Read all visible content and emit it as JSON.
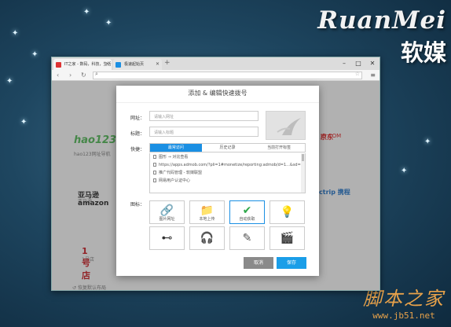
{
  "brand": {
    "english": "RuanMei",
    "chinese": "软媒"
  },
  "watermark": {
    "chinese": "脚本之家",
    "url": "www.jb51.net"
  },
  "browser": {
    "tabs": [
      {
        "label": "IT之家 - 数码，科技，生活"
      },
      {
        "label": "极速起始页"
      }
    ],
    "new_tab": "+",
    "window_controls": {
      "minimize": "–",
      "maximize": "□",
      "close": "✕"
    },
    "back": "‹",
    "forward": "›",
    "reload": "↻",
    "address_placeholder": "",
    "tiles": [
      {
        "logo": "hao123",
        "caption": "hao123网址导航"
      },
      {
        "logo": "京东",
        "caption": "JD.COM"
      },
      {
        "logo": "亚马逊 amazon",
        "caption": "亚马逊"
      },
      {
        "logo": "ctrip 携程",
        "caption": ""
      },
      {
        "logo": "1号店",
        "caption": "1号店"
      }
    ],
    "footer_link": "恢复默认布局"
  },
  "dialog": {
    "title": "添加 & 编辑快速拨号",
    "url_label": "网址：",
    "url_placeholder": "请输入网址",
    "title_label": "标题：",
    "title_placeholder": "请输入标题",
    "quick_label": "快捷：",
    "quick_tabs": [
      {
        "label": "最常访问",
        "active": true
      },
      {
        "label": "历史记录",
        "active": false
      },
      {
        "label": "当前打开标签",
        "active": false
      }
    ],
    "quick_list": [
      "图形 → 对比查看",
      "https://apps.admob.com/?pli=1#monetize/reporting:admob/d=1...&sd=...",
      "推广代码管理 - 软媒联盟",
      "网易用户认证中心"
    ],
    "icon_label": "图标：",
    "icon_options": [
      {
        "icon": "link-icon",
        "glyph": "🔗",
        "label": "图片网址",
        "selected": false
      },
      {
        "icon": "folder-icon",
        "glyph": "📁",
        "label": "本地上传",
        "selected": false
      },
      {
        "icon": "check-icon",
        "glyph": "✔",
        "label": "自动获取",
        "selected": true
      },
      {
        "icon": "lightbulb-icon",
        "glyph": "💡",
        "label": "",
        "selected": false
      },
      {
        "icon": "usb-icon",
        "glyph": "⊷",
        "label": "",
        "selected": false
      },
      {
        "icon": "headphones-icon",
        "glyph": "🎧",
        "label": "",
        "selected": false
      },
      {
        "icon": "pencil-icon",
        "glyph": "✎",
        "label": "",
        "selected": false
      },
      {
        "icon": "clapperboard-icon",
        "glyph": "🎬",
        "label": "",
        "selected": false
      }
    ],
    "cancel_label": "取消",
    "save_label": "保存"
  },
  "colors": {
    "accent": "#1a8fe3",
    "save": "#1a9ee8",
    "cancel": "#8a8a8a"
  }
}
